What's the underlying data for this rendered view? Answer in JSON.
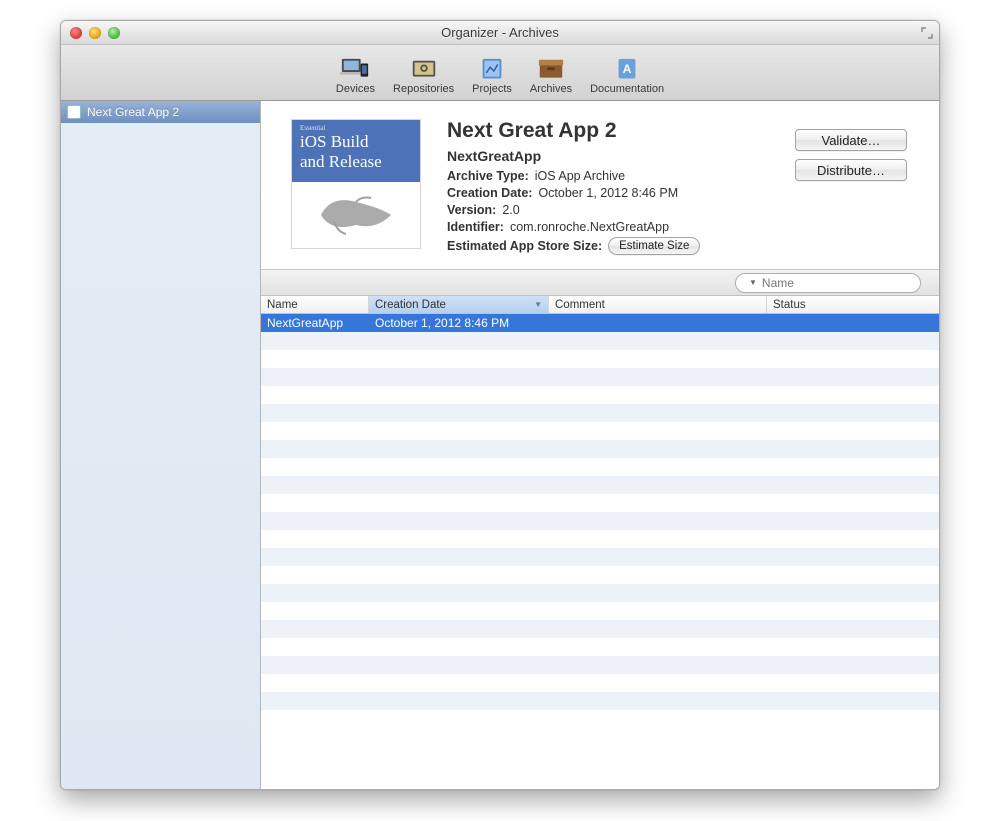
{
  "window": {
    "title": "Organizer - Archives"
  },
  "toolbar": {
    "items": [
      {
        "label": "Devices"
      },
      {
        "label": "Repositories"
      },
      {
        "label": "Projects"
      },
      {
        "label": "Archives"
      },
      {
        "label": "Documentation"
      }
    ]
  },
  "sidebar": {
    "items": [
      {
        "label": "Next Great App 2"
      }
    ]
  },
  "detail": {
    "title": "Next Great App 2",
    "subtitle": "NextGreatApp",
    "artwork": {
      "ess": "Essential",
      "line1": "iOS Build",
      "line2": "and Release"
    },
    "fields": {
      "archive_type_label": "Archive Type:",
      "archive_type_value": "iOS App Archive",
      "creation_date_label": "Creation Date:",
      "creation_date_value": "October 1, 2012 8:46 PM",
      "version_label": "Version:",
      "version_value": "2.0",
      "identifier_label": "Identifier:",
      "identifier_value": "com.ronroche.NextGreatApp",
      "size_label": "Estimated App Store Size:",
      "estimate_btn": "Estimate Size"
    },
    "actions": {
      "validate": "Validate…",
      "distribute": "Distribute…"
    }
  },
  "search": {
    "placeholder": "Name"
  },
  "table": {
    "columns": {
      "name": "Name",
      "creation_date": "Creation Date",
      "comment": "Comment",
      "status": "Status"
    },
    "rows": [
      {
        "name": "NextGreatApp",
        "creation_date": "October 1, 2012 8:46 PM",
        "comment": "",
        "status": ""
      }
    ]
  }
}
